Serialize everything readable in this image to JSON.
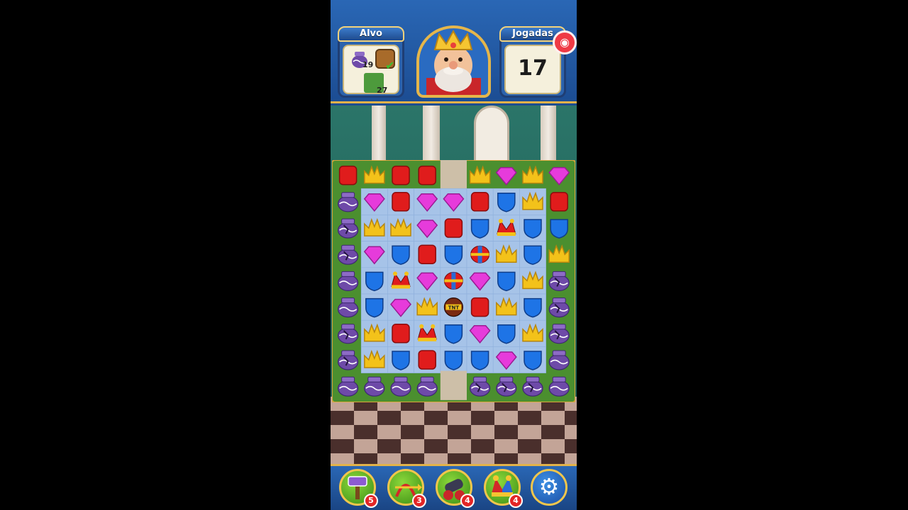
{
  "hud": {
    "goal_title": "Alvo",
    "moves_title": "Jogadas",
    "moves_left": "17",
    "goals": [
      {
        "item": "pot-icon",
        "count": "19"
      },
      {
        "item": "box-icon",
        "count": "✔"
      },
      {
        "item": "grass-icon",
        "count": "27"
      }
    ]
  },
  "boosters": [
    {
      "name": "hammer-icon",
      "count": "5"
    },
    {
      "name": "arrow-icon",
      "count": "3"
    },
    {
      "name": "cannon-icon",
      "count": "4"
    },
    {
      "name": "jester-hat-icon",
      "count": "4"
    }
  ],
  "colors": {
    "red": "#e01c1c",
    "yellow": "#f3c21a",
    "pink": "#e63bdb",
    "blue": "#1e74e6",
    "pot": "#6e4aa8",
    "bg_cell": "#a6c3e8",
    "grass": "#4b8f2f"
  },
  "board": {
    "rows": 9,
    "cols": 9,
    "legend": {
      "R": "red-cube",
      "Y": "yellow-crown",
      "P": "pink-gem",
      "B": "blue-shield",
      "V": "purple-pot",
      "V2": "cracked-pot",
      "J": "jester-hat",
      "S": "spinner-rocket",
      "T": "tnt-bomb",
      "_": "empty"
    },
    "grid": [
      [
        "R",
        "Y",
        "R",
        "R",
        "_",
        "Y",
        "P",
        "Y",
        "P"
      ],
      [
        "V",
        "P",
        "R",
        "P",
        "P",
        "R",
        "B",
        "Y",
        "R"
      ],
      [
        "V2",
        "Y",
        "Y",
        "P",
        "R",
        "B",
        "J",
        "B",
        "B"
      ],
      [
        "V2",
        "P",
        "B",
        "R",
        "B",
        "S",
        "Y",
        "B",
        "Y"
      ],
      [
        "V",
        "B",
        "J",
        "P",
        "S",
        "P",
        "B",
        "Y",
        "V2"
      ],
      [
        "V",
        "B",
        "P",
        "Y",
        "T",
        "R",
        "Y",
        "B",
        "V2"
      ],
      [
        "V2",
        "Y",
        "R",
        "J",
        "B",
        "P",
        "B",
        "Y",
        "V2"
      ],
      [
        "V2",
        "Y",
        "B",
        "R",
        "B",
        "B",
        "P",
        "B",
        "V"
      ],
      [
        "V",
        "V",
        "V",
        "V",
        "_",
        "V2",
        "V2",
        "V2",
        "V"
      ]
    ]
  }
}
